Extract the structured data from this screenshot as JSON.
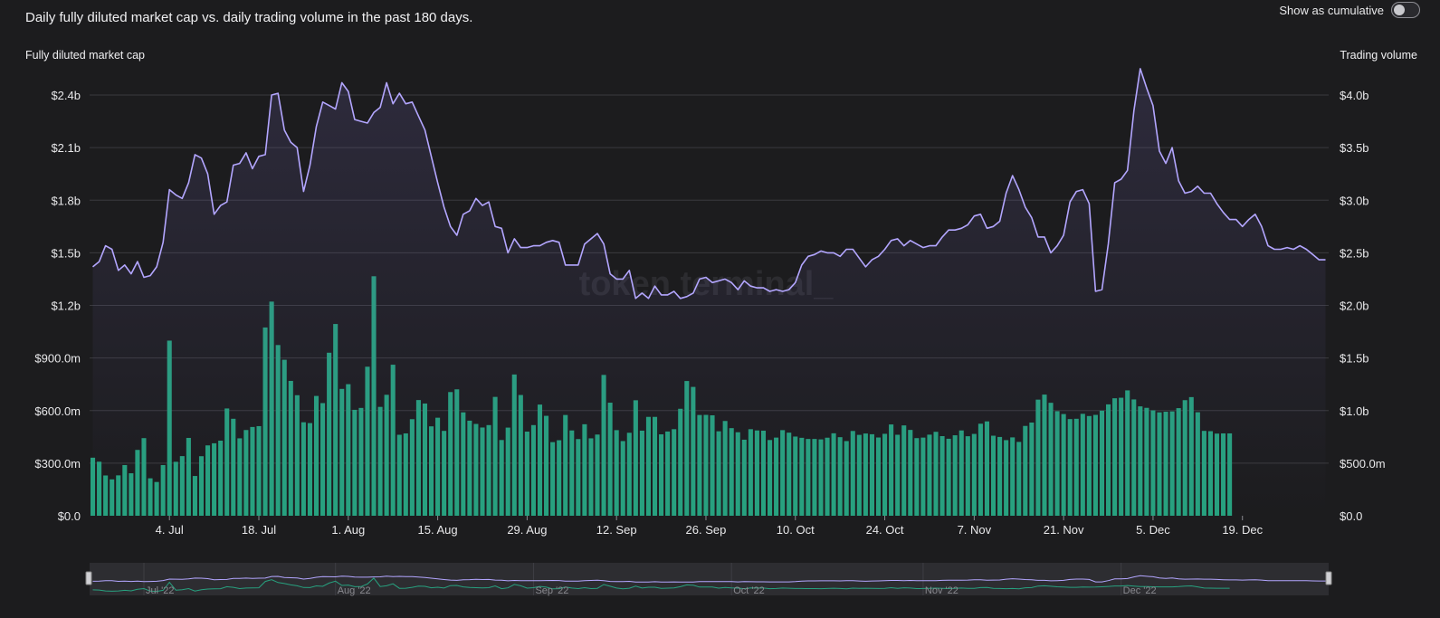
{
  "header": {
    "title": "Daily fully diluted market cap vs. daily trading volume in the past 180 days.",
    "cumulative_label": "Show as cumulative"
  },
  "axes": {
    "left_title": "Fully diluted market cap",
    "right_title": "Trading volume"
  },
  "watermark": "token terminal_",
  "colors": {
    "line": "#b3a6ff",
    "bar": "#27a17f",
    "background": "#1c1c1e",
    "grid": "#3a3a3e"
  },
  "navigator": {
    "labels": [
      "Jul '22",
      "Aug '22",
      "Sep '22",
      "Oct '22",
      "Nov '22",
      "Dec '22"
    ]
  },
  "chart_data": {
    "type": "bar+line",
    "x_tick_labels": [
      "4. Jul",
      "18. Jul",
      "1. Aug",
      "15. Aug",
      "29. Aug",
      "12. Sep",
      "26. Sep",
      "10. Oct",
      "24. Oct",
      "7. Nov",
      "21. Nov",
      "5. Dec",
      "19. Dec"
    ],
    "y_left_ticks": [
      "$0.0",
      "$300.0m",
      "$600.0m",
      "$900.0m",
      "$1.2b",
      "$1.5b",
      "$1.8b",
      "$2.1b",
      "$2.4b"
    ],
    "y_right_ticks": [
      "$0.0",
      "$500.0m",
      "$1.0b",
      "$1.5b",
      "$2.0b",
      "$2.5b",
      "$3.0b",
      "$3.5b",
      "$4.0b"
    ],
    "y_left_range": [
      0,
      2400000000
    ],
    "y_right_range": [
      0,
      4000000000
    ],
    "series": [
      {
        "name": "Fully diluted market cap",
        "type": "line",
        "axis": "left",
        "values": [
          1.42,
          1.45,
          1.54,
          1.52,
          1.4,
          1.43,
          1.38,
          1.45,
          1.36,
          1.37,
          1.42,
          1.56,
          1.86,
          1.83,
          1.81,
          1.9,
          2.06,
          2.04,
          1.95,
          1.72,
          1.77,
          1.79,
          2.0,
          2.01,
          2.07,
          1.98,
          2.05,
          2.06,
          2.4,
          2.41,
          2.2,
          2.13,
          2.1,
          1.85,
          2.0,
          2.22,
          2.36,
          2.34,
          2.32,
          2.47,
          2.42,
          2.26,
          2.25,
          2.24,
          2.3,
          2.33,
          2.47,
          2.35,
          2.41,
          2.35,
          2.36,
          2.28,
          2.2,
          2.05,
          1.9,
          1.76,
          1.65,
          1.6,
          1.72,
          1.74,
          1.81,
          1.77,
          1.79,
          1.65,
          1.64,
          1.5,
          1.58,
          1.53,
          1.53,
          1.54,
          1.54,
          1.56,
          1.57,
          1.56,
          1.43,
          1.43,
          1.43,
          1.55,
          1.58,
          1.61,
          1.55,
          1.38,
          1.35,
          1.35,
          1.4,
          1.24,
          1.27,
          1.24,
          1.31,
          1.26,
          1.26,
          1.28,
          1.24,
          1.25,
          1.27,
          1.35,
          1.36,
          1.33,
          1.34,
          1.35,
          1.33,
          1.29,
          1.34,
          1.31,
          1.3,
          1.3,
          1.28,
          1.29,
          1.28,
          1.29,
          1.33,
          1.43,
          1.48,
          1.49,
          1.51,
          1.5,
          1.5,
          1.48,
          1.52,
          1.52,
          1.47,
          1.42,
          1.46,
          1.48,
          1.52,
          1.57,
          1.58,
          1.54,
          1.57,
          1.55,
          1.53,
          1.54,
          1.54,
          1.59,
          1.63,
          1.63,
          1.64,
          1.66,
          1.71,
          1.72,
          1.64,
          1.65,
          1.68,
          1.84,
          1.94,
          1.86,
          1.76,
          1.7,
          1.59,
          1.59,
          1.5,
          1.54,
          1.6,
          1.79,
          1.85,
          1.86,
          1.78,
          1.28,
          1.29,
          1.55,
          1.9,
          1.92,
          1.97,
          2.31,
          2.55,
          2.44,
          2.34,
          2.08,
          2.01,
          2.1,
          1.91,
          1.84,
          1.85,
          1.88,
          1.84,
          1.84,
          1.78,
          1.73,
          1.69,
          1.69,
          1.65,
          1.69,
          1.72,
          1.65,
          1.54,
          1.52,
          1.52,
          1.53,
          1.52,
          1.54,
          1.52,
          1.49,
          1.46,
          1.46
        ]
      },
      {
        "name": "Trading volume",
        "type": "bar",
        "axis": "right",
        "values": [
          0.552,
          0.514,
          0.383,
          0.346,
          0.384,
          0.482,
          0.404,
          0.626,
          0.738,
          0.356,
          0.321,
          0.482,
          1.665,
          0.513,
          0.567,
          0.74,
          0.378,
          0.566,
          0.669,
          0.689,
          0.714,
          1.02,
          0.922,
          0.736,
          0.815,
          0.844,
          0.852,
          1.79,
          2.036,
          1.623,
          1.483,
          1.282,
          1.146,
          0.889,
          0.881,
          1.139,
          1.071,
          1.55,
          1.823,
          1.206,
          1.251,
          1.007,
          1.025,
          1.417,
          2.277,
          1.035,
          1.15,
          1.436,
          0.77,
          0.783,
          0.918,
          1.1,
          1.067,
          0.85,
          0.932,
          0.807,
          1.176,
          1.202,
          0.983,
          0.904,
          0.873,
          0.839,
          0.862,
          1.13,
          0.72,
          0.838,
          1.343,
          1.148,
          0.8,
          0.862,
          1.057,
          0.95,
          0.7,
          0.718,
          0.958,
          0.811,
          0.729,
          0.87,
          0.736,
          0.772,
          1.339,
          1.075,
          0.814,
          0.71,
          0.789,
          1.098,
          0.809,
          0.94,
          0.94,
          0.774,
          0.801,
          0.823,
          1.017,
          1.281,
          1.225,
          0.958,
          0.959,
          0.955,
          0.803,
          0.901,
          0.833,
          0.794,
          0.723,
          0.823,
          0.811,
          0.809,
          0.72,
          0.743,
          0.814,
          0.79,
          0.753,
          0.741,
          0.73,
          0.73,
          0.726,
          0.742,
          0.784,
          0.747,
          0.71,
          0.806,
          0.769,
          0.782,
          0.775,
          0.744,
          0.779,
          0.868,
          0.77,
          0.859,
          0.816,
          0.738,
          0.743,
          0.771,
          0.798,
          0.757,
          0.732,
          0.765,
          0.811,
          0.756,
          0.778,
          0.875,
          0.897,
          0.761,
          0.749,
          0.719,
          0.745,
          0.702,
          0.854,
          0.886,
          1.104,
          1.152,
          1.074,
          0.994,
          0.967,
          0.919,
          0.922,
          0.969,
          0.948,
          0.959,
          0.999,
          1.059,
          1.117,
          1.122,
          1.192,
          1.106,
          1.04,
          1.026,
          1.002,
          0.983,
          0.989,
          0.992,
          1.023,
          1.099,
          1.128,
          0.984,
          0.807,
          0.804,
          0.781,
          0.783,
          0.783
        ]
      }
    ]
  }
}
